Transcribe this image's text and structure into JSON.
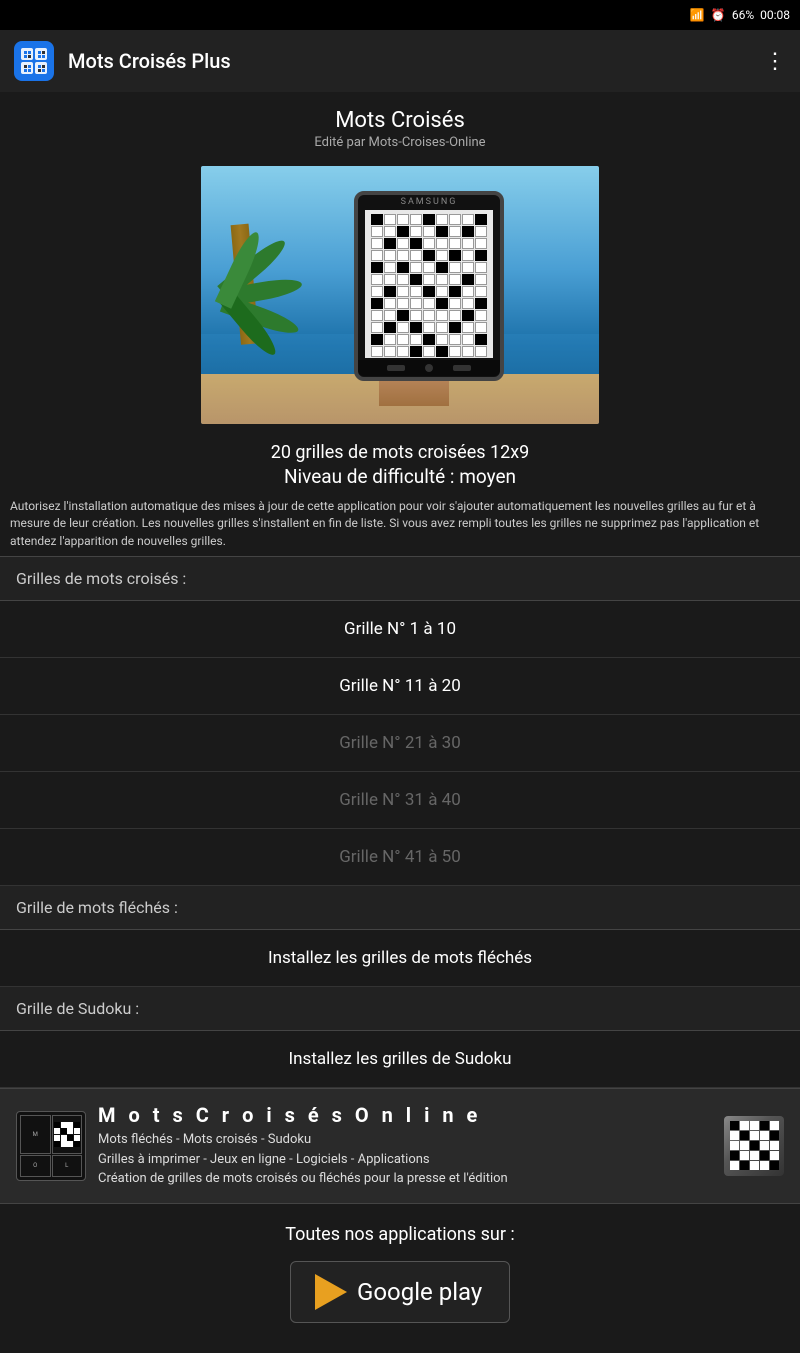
{
  "statusBar": {
    "signal": "▊▊▊",
    "alarm": "⏰",
    "battery": "66%",
    "time": "00:08"
  },
  "appBar": {
    "title": "Mots Croisés Plus",
    "menuIcon": "⋮"
  },
  "header": {
    "appName": "Mots Croisés",
    "editor": "Edité par Mots-Croises-Online"
  },
  "description": {
    "main": "20 grilles de mots croisées 12x9",
    "level": "Niveau de difficulté : moyen"
  },
  "autoInstallText": "Autorisez l'installation automatique des mises à jour de cette application pour voir s'ajouter automatiquement les nouvelles grilles au fur et à mesure de leur création. Les nouvelles grilles s'installent en fin de liste. Si vous avez rempli toutes les grilles ne supprimez pas l'application et attendez l'apparition de nouvelles grilles.",
  "sections": {
    "crossword": {
      "header": "Grilles de mots croisés :",
      "items": [
        {
          "label": "Grille N° 1 à 10",
          "enabled": true
        },
        {
          "label": "Grille N° 11 à 20",
          "enabled": true
        },
        {
          "label": "Grille N° 21 à 30",
          "enabled": false
        },
        {
          "label": "Grille N° 31 à 40",
          "enabled": false
        },
        {
          "label": "Grille N° 41 à 50",
          "enabled": false
        }
      ]
    },
    "fleche": {
      "header": "Grille de mots fléchés :",
      "item": "Installez les grilles de mots fléchés"
    },
    "sudoku": {
      "header": "Grille de Sudoku :",
      "item": "Installez les grilles de Sudoku"
    }
  },
  "footerBanner": {
    "logoText": "MOTS\nCROIS\nES\nONLINE",
    "title": "M o t s   C r o i s é s   O n l i n e",
    "lines": [
      "Mots fléchés  -  Mots croisés  -  Sudoku",
      "Grilles à imprimer - Jeux en ligne - Logiciels - Applications",
      "Création de grilles de mots croisés ou fléchés pour la presse et l'édition"
    ]
  },
  "googlePlay": {
    "label": "Toutes nos applications sur :",
    "buttonText": "Google play"
  }
}
